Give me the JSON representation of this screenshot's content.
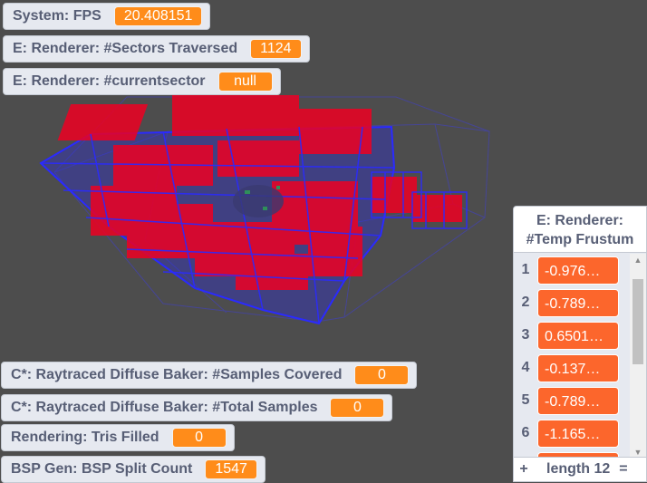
{
  "monitors": {
    "fps": {
      "label": "System: FPS",
      "value": "20.408151"
    },
    "sectors": {
      "label": "E: Renderer: #Sectors Traversed",
      "value": "1124"
    },
    "current_sector": {
      "label": "E: Renderer: #currentsector",
      "value": "null"
    },
    "samples_covered": {
      "label": "C*: Raytraced Diffuse Baker: #Samples Covered",
      "value": "0"
    },
    "total_samples": {
      "label": "C*: Raytraced Diffuse Baker: #Total Samples",
      "value": "0"
    },
    "tris_filled": {
      "label": "Rendering: Tris Filled",
      "value": "0"
    },
    "bsp_split": {
      "label": "BSP Gen: BSP Split Count",
      "value": "1547"
    }
  },
  "list": {
    "title_line1": "E: Renderer:",
    "title_line2": "#Temp Frustum",
    "items": [
      {
        "index": "1",
        "value": "-0.976…"
      },
      {
        "index": "2",
        "value": "-0.789…"
      },
      {
        "index": "3",
        "value": "0.6501…"
      },
      {
        "index": "4",
        "value": "-0.137…"
      },
      {
        "index": "5",
        "value": "-0.789…"
      },
      {
        "index": "6",
        "value": "-1.165…"
      }
    ],
    "add_label": "+",
    "length_label": "length 12",
    "resize_label": "="
  },
  "colors": {
    "background": "#4d4d4d",
    "monitor_value": "#ff8c1a",
    "list_value": "#fc662c",
    "wireframe_blue": "#2a2aff",
    "wireframe_red": "#ff0033"
  }
}
